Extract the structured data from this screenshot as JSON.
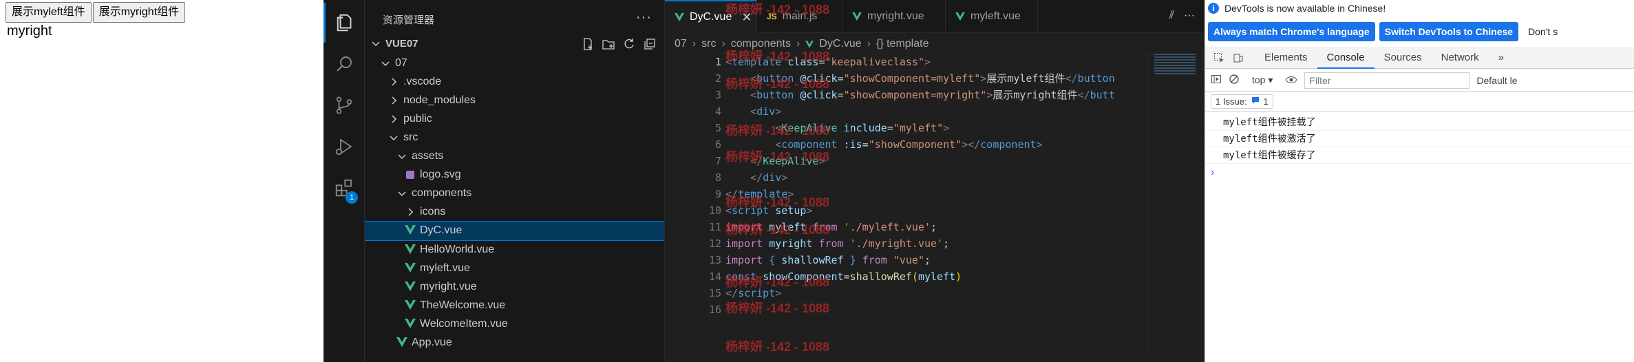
{
  "page": {
    "buttons": [
      "展示myleft组件",
      "展示myright组件"
    ],
    "content": "myright"
  },
  "vscode": {
    "explorer_title": "资源管理器",
    "explorer_more": "···",
    "root_folder": "VUE07",
    "extensions_badge": "1",
    "tree": [
      {
        "label": "07",
        "depth": 1,
        "kind": "folder-open"
      },
      {
        "label": ".vscode",
        "depth": 2,
        "kind": "folder"
      },
      {
        "label": "node_modules",
        "depth": 2,
        "kind": "folder"
      },
      {
        "label": "public",
        "depth": 2,
        "kind": "folder"
      },
      {
        "label": "src",
        "depth": 2,
        "kind": "folder-open"
      },
      {
        "label": "assets",
        "depth": 3,
        "kind": "folder-open"
      },
      {
        "label": "logo.svg",
        "depth": 4,
        "kind": "svg"
      },
      {
        "label": "components",
        "depth": 3,
        "kind": "folder-open"
      },
      {
        "label": "icons",
        "depth": 4,
        "kind": "folder"
      },
      {
        "label": "DyC.vue",
        "depth": 4,
        "kind": "vue",
        "selected": true
      },
      {
        "label": "HelloWorld.vue",
        "depth": 4,
        "kind": "vue"
      },
      {
        "label": "myleft.vue",
        "depth": 4,
        "kind": "vue"
      },
      {
        "label": "myright.vue",
        "depth": 4,
        "kind": "vue"
      },
      {
        "label": "TheWelcome.vue",
        "depth": 4,
        "kind": "vue"
      },
      {
        "label": "WelcomeItem.vue",
        "depth": 4,
        "kind": "vue"
      },
      {
        "label": "App.vue",
        "depth": 3,
        "kind": "vue"
      }
    ],
    "tabs": [
      {
        "label": "DyC.vue",
        "icon": "vue",
        "active": true,
        "close": "✕"
      },
      {
        "label": "main.js",
        "icon": "js",
        "icon_text": "JS"
      },
      {
        "label": "myright.vue",
        "icon": "vue"
      },
      {
        "label": "myleft.vue",
        "icon": "vue"
      }
    ],
    "tab_actions": [
      "⫽",
      "···"
    ],
    "breadcrumb": [
      "07",
      "src",
      "components",
      "DyC.vue",
      "{} template"
    ],
    "line_numbers": [
      "1",
      "2",
      "3",
      "4",
      "5",
      "6",
      "7",
      "8",
      "9",
      "10",
      "11",
      "12",
      "13",
      "14",
      "15",
      "16"
    ],
    "watermark": "杨梓妍 -142 - 1088"
  },
  "devtools": {
    "info": "DevTools is now available in Chinese!",
    "info_icon": "i",
    "btn_match": "Always match Chrome's language",
    "btn_switch": "Switch DevTools to Chinese",
    "btn_dont": "Don't s",
    "tabs": [
      "Elements",
      "Console",
      "Sources",
      "Network"
    ],
    "more_tabs": "»",
    "context": "top ▾",
    "filter_placeholder": "Filter",
    "default_levels": "Default le",
    "issues": "1 Issue:",
    "issue_count": "1",
    "logs": [
      "myleft组件被挂载了",
      "myleft组件被激活了",
      "myleft组件被缓存了"
    ],
    "prompt": "›"
  }
}
